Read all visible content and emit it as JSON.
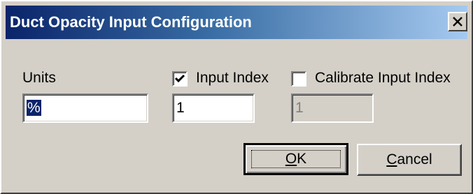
{
  "dialog": {
    "title": "Duct Opacity Input Configuration",
    "close_icon": "close-icon"
  },
  "units": {
    "label": "Units",
    "value": "%"
  },
  "input_index": {
    "label": "Input Index",
    "checked": true,
    "value": "1"
  },
  "calibrate_input_index": {
    "label": "Calibrate Input Index",
    "checked": false,
    "value": "1",
    "disabled": true
  },
  "buttons": {
    "ok_accel": "O",
    "ok_rest": "K",
    "cancel_accel": "C",
    "cancel_rest": "ancel"
  },
  "colors": {
    "face": "#d4d0c8",
    "title_start": "#0a246a",
    "title_end": "#a6caf0",
    "selection": "#0a246a"
  }
}
